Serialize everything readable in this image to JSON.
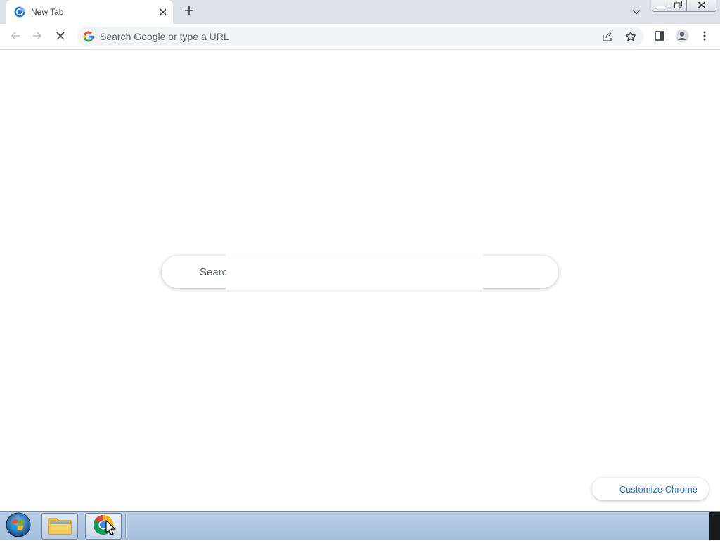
{
  "tab": {
    "title": "New Tab",
    "favicon": "chromium-favicon-icon",
    "close": "close-icon"
  },
  "tabstrip": {
    "new_tab": "plus-icon",
    "tab_search": "chevron-down-icon"
  },
  "window_controls": {
    "minimize": "minimize-icon",
    "restore": "restore-icon",
    "close": "close-icon"
  },
  "toolbar": {
    "back": "back-arrow-icon",
    "forward": "forward-arrow-icon",
    "stop": "stop-icon",
    "side_panel": "side-panel-icon",
    "profile": "profile-icon",
    "menu": "kebab-menu-icon"
  },
  "omnibox": {
    "placeholder": "Search Google or type a URL",
    "value": "",
    "share": "share-icon",
    "bookmark": "star-icon"
  },
  "ntp": {
    "search_text": "Searc",
    "customize_label": "Customize Chrome"
  },
  "taskbar": {
    "start": "windows-start-icon",
    "items": [
      {
        "name": "explorer-icon"
      },
      {
        "name": "chrome-icon"
      }
    ]
  },
  "colors": {
    "tabstrip_bg": "#dee1e6",
    "omnibox_bg": "#f1f3f4",
    "accent": "#1a73e8",
    "taskbar_bg": "#b9cfe6"
  }
}
